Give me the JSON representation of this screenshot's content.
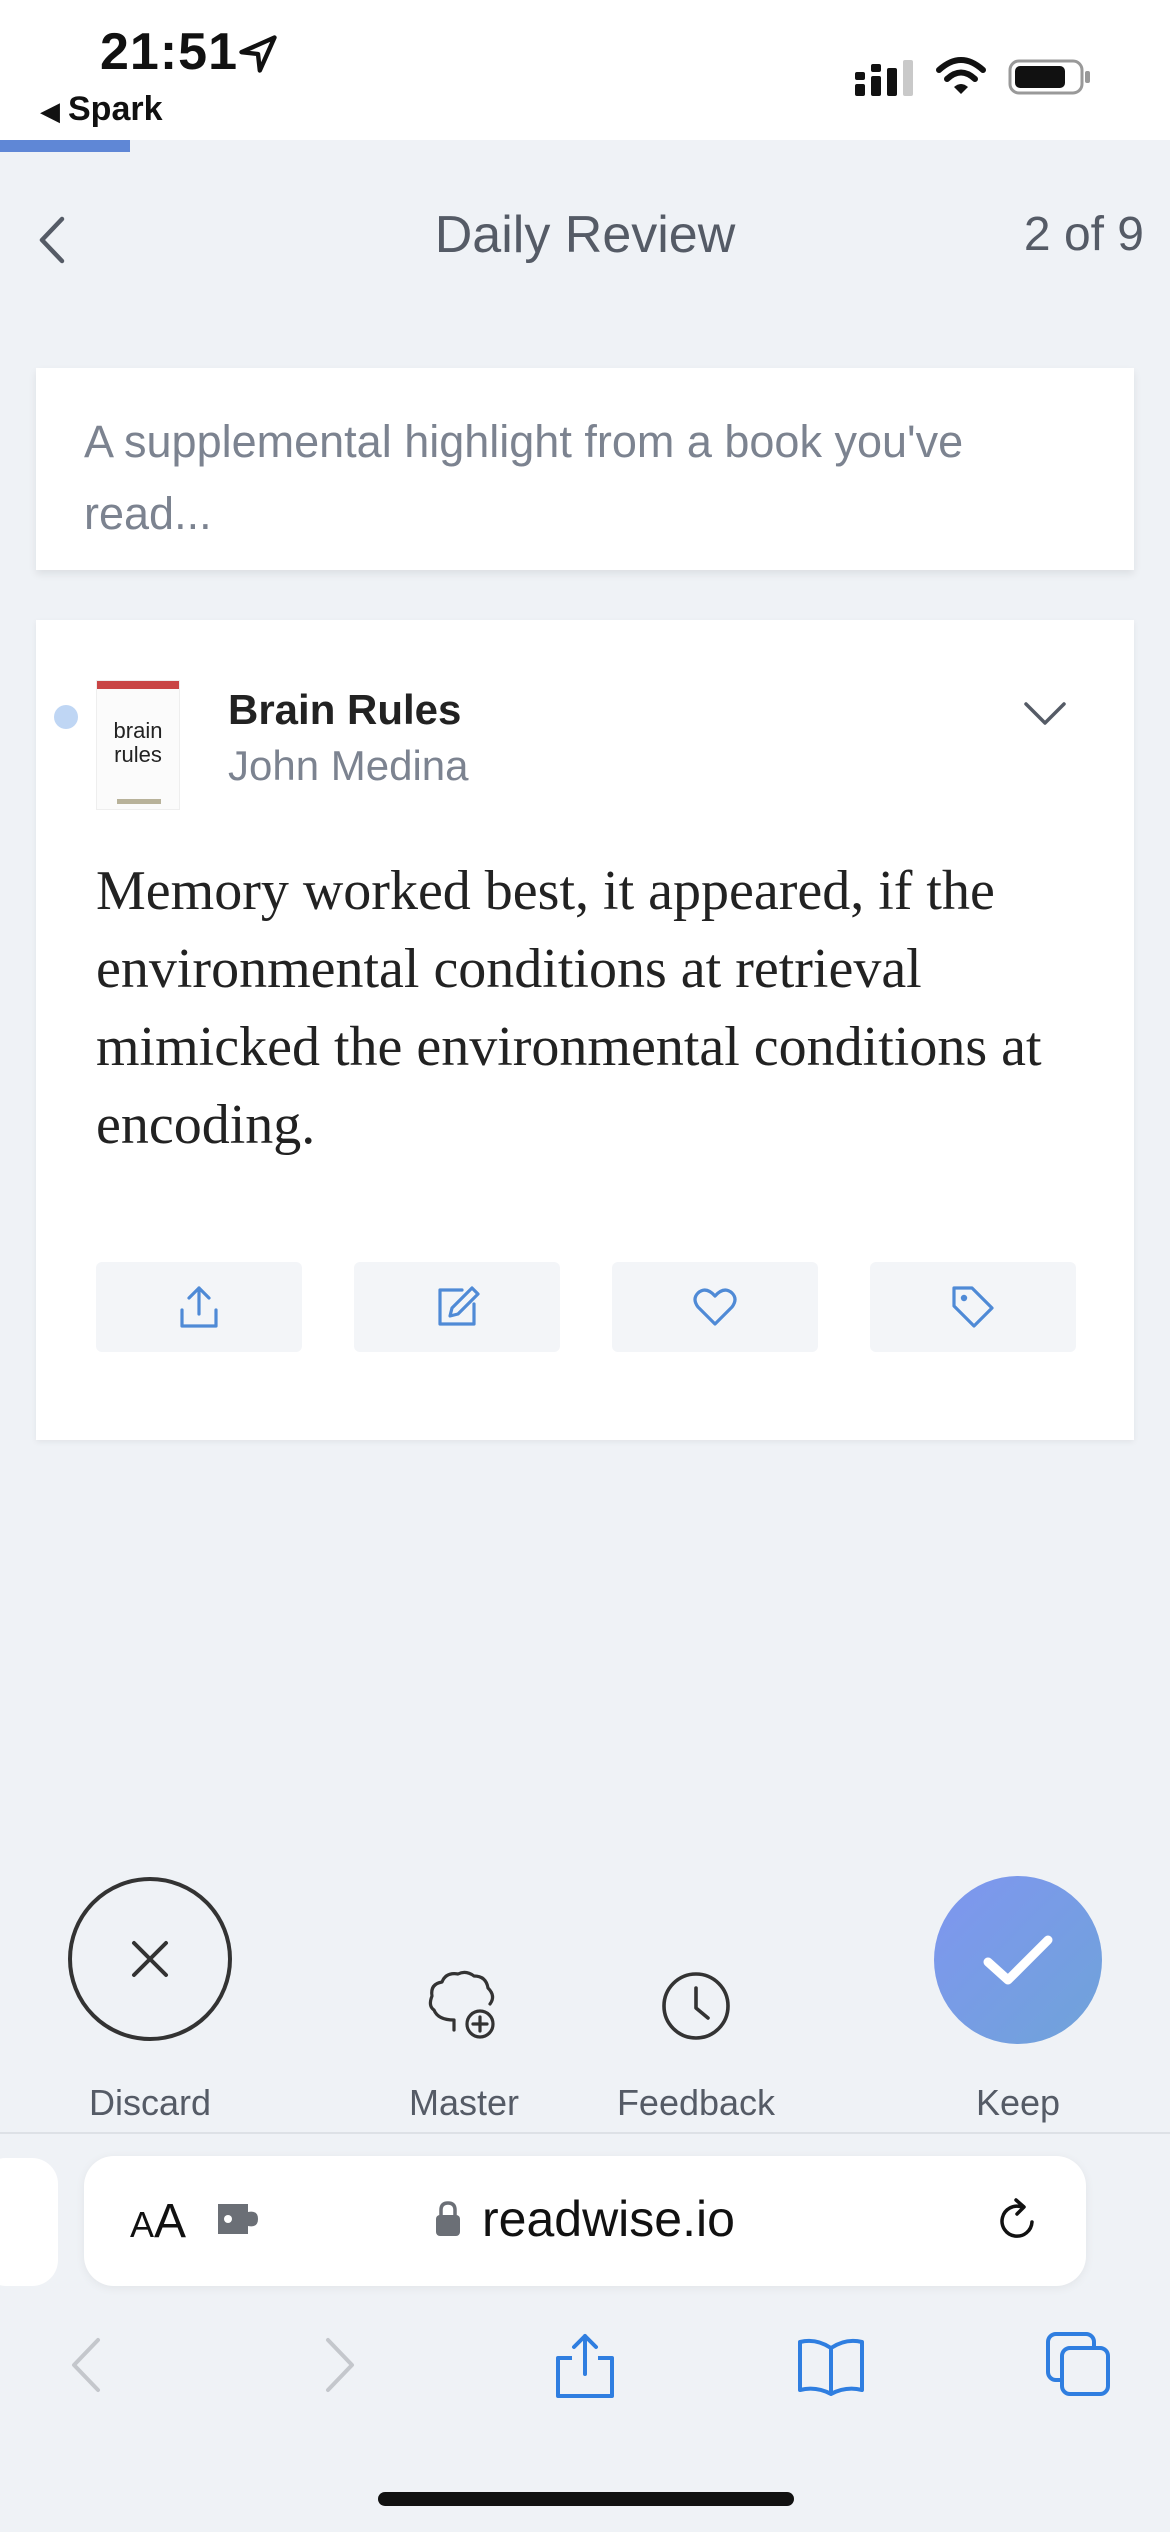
{
  "status_bar": {
    "time": "21:51",
    "back_app": "Spark",
    "icons": [
      "location-arrow-icon",
      "signal-icon",
      "wifi-icon",
      "battery-icon"
    ]
  },
  "review_progress_fraction": 0.11,
  "header": {
    "back_icon": "chevron-left-icon",
    "title": "Daily Review",
    "counter": "2 of 9"
  },
  "banner": {
    "text": "A supplemental highlight from a book you've read..."
  },
  "highlight": {
    "book_title": "Brain Rules",
    "author": "John Medina",
    "cover_text_line1": "brain",
    "cover_text_line2": "rules",
    "quote": "Memory worked best, it appeared, if the environmental conditions at retrieval mimicked the environmental conditions at encoding.",
    "actions": [
      "share-icon",
      "edit-icon",
      "heart-icon",
      "tag-icon"
    ]
  },
  "review_actions": {
    "discard": "Discard",
    "master": "Master",
    "feedback": "Feedback",
    "keep": "Keep"
  },
  "browser": {
    "aa_label_big": "A",
    "aa_label_small": "A",
    "domain": "readwise.io",
    "toolbar": [
      "back-icon",
      "forward-icon",
      "share-icon",
      "bookmarks-icon",
      "tabs-icon"
    ]
  },
  "colors": {
    "accent": "#5f87d6",
    "keep_gradient_start": "#7f96f0",
    "keep_gradient_end": "#6fa3d9",
    "browser_blue": "#2f7ee0"
  }
}
